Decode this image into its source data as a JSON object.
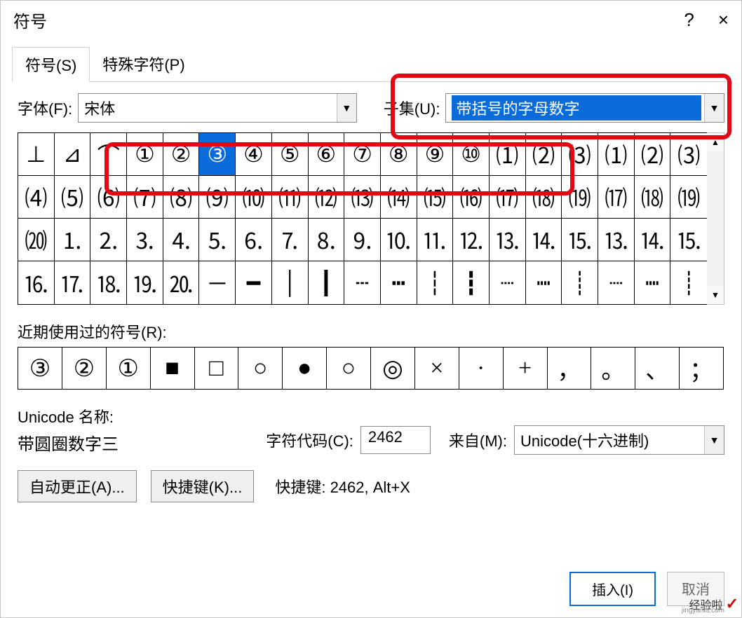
{
  "dialog": {
    "title": "符号",
    "help_icon": "?",
    "close_icon": "×"
  },
  "tabs": {
    "symbols": "符号(S)",
    "special": "特殊字符(P)"
  },
  "font": {
    "label": "字体(F):",
    "value": "宋体"
  },
  "subset": {
    "label": "子集(U):",
    "value": "带括号的字母数字"
  },
  "grid": {
    "rows": [
      [
        "⊥",
        "⊿",
        "⌒",
        "①",
        "②",
        "③",
        "④",
        "⑤",
        "⑥",
        "⑦",
        "⑧",
        "⑨",
        "⑩",
        "⑴",
        "⑵",
        "⑶"
      ],
      [
        "⑷",
        "⑸",
        "⑹",
        "⑺",
        "⑻",
        "⑼",
        "⑽",
        "⑾",
        "⑿",
        "⒀",
        "⒁",
        "⒂",
        "⒃",
        "⒄",
        "⒅",
        "⒆"
      ],
      [
        "⒇",
        "⒈",
        "⒉",
        "⒊",
        "⒋",
        "⒌",
        "⒍",
        "⒎",
        "⒏",
        "⒐",
        "⒑",
        "⒒",
        "⒓",
        "⒔",
        "⒕",
        "⒖"
      ],
      [
        "⒗",
        "⒘",
        "⒙",
        "⒚",
        "⒛",
        "─",
        "━",
        "│",
        "┃",
        "┄",
        "┅",
        "┆",
        "┇",
        "┈",
        "┉",
        "┊"
      ]
    ],
    "extra_cols": [
      [
        "⑴",
        "⑵",
        "⑶"
      ],
      [
        "⒄",
        "⒅",
        "⒆"
      ],
      [
        "⒔",
        "⒕",
        "⒖"
      ],
      [
        "┈",
        "┉",
        "┊"
      ]
    ],
    "selected_index": [
      0,
      5
    ]
  },
  "recent": {
    "label": "近期使用过的符号(R):",
    "items": [
      "③",
      "②",
      "①",
      "■",
      "□",
      "○",
      "●",
      "○",
      "◎",
      "×",
      "·",
      "+",
      "，",
      "。",
      "、",
      "；"
    ]
  },
  "unicode": {
    "name_label": "Unicode 名称:",
    "name_value": "带圆圈数字三",
    "code_label": "字符代码(C):",
    "code_value": "2462",
    "from_label": "来自(M):",
    "from_value": "Unicode(十六进制)"
  },
  "buttons": {
    "autocorrect": "自动更正(A)...",
    "shortcut": "快捷键(K)...",
    "shortcut_label": "快捷键: 2462, Alt+X",
    "insert": "插入(I)",
    "cancel": "取消"
  },
  "watermark": {
    "text": "经验啦",
    "sub": "jingyanla.com"
  }
}
